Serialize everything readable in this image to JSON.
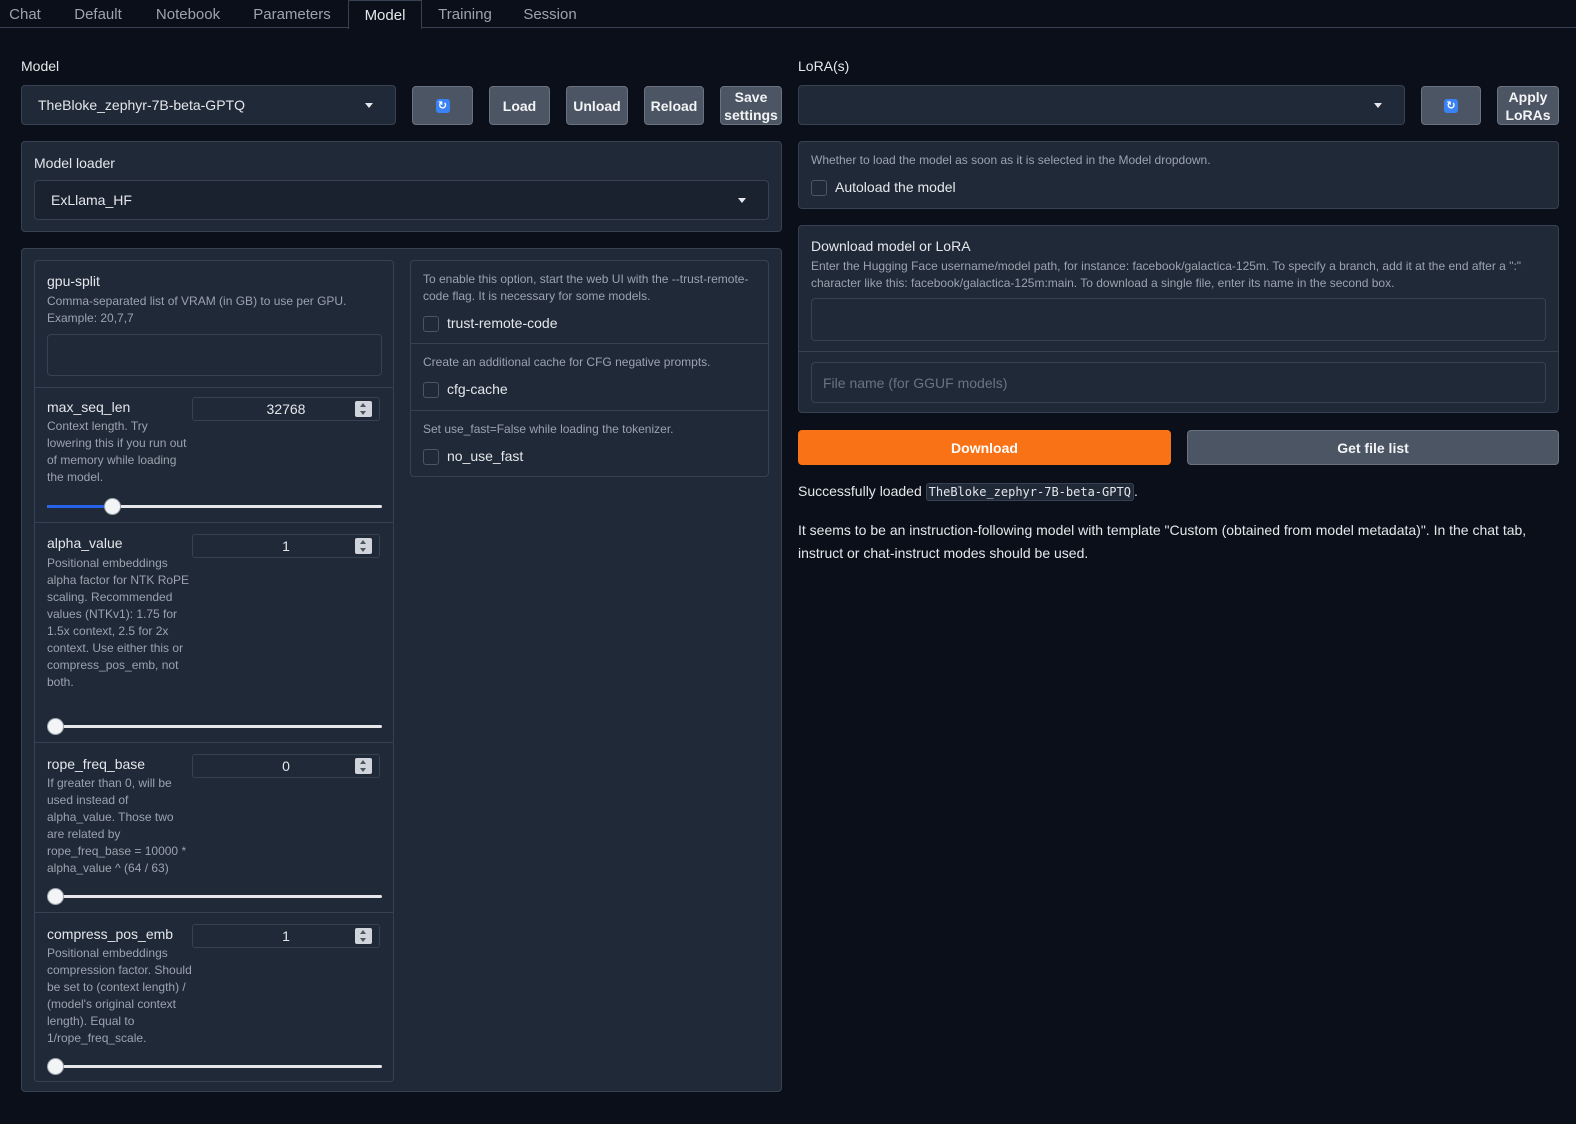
{
  "tabs": [
    "Chat",
    "Default",
    "Notebook",
    "Parameters",
    "Model",
    "Training",
    "Session"
  ],
  "active_tab": "Model",
  "model": {
    "label": "Model",
    "selected": "TheBloke_zephyr-7B-beta-GPTQ",
    "load": "Load",
    "unload": "Unload",
    "reload": "Reload",
    "save_settings": "Save settings"
  },
  "lora": {
    "label": "LoRA(s)",
    "selected": "",
    "apply": "Apply LoRAs"
  },
  "loader": {
    "label": "Model loader",
    "selected": "ExLlama_HF"
  },
  "gpu_split": {
    "label": "gpu-split",
    "info": "Comma-separated list of VRAM (in GB) to use per GPU. Example: 20,7,7",
    "value": ""
  },
  "sliders": {
    "max_seq_len": {
      "label": "max_seq_len",
      "value": "32768",
      "info": "Context length. Try lowering this if you run out of memory while loading the model.",
      "fraction": 0.18
    },
    "alpha_value": {
      "label": "alpha_value",
      "value": "1",
      "info": "Positional embeddings alpha factor for NTK RoPE scaling. Recommended values (NTKv1): 1.75 for 1.5x context, 2.5 for 2x context. Use either this or compress_pos_emb, not both.",
      "fraction": 0
    },
    "rope_freq_base": {
      "label": "rope_freq_base",
      "value": "0",
      "info": "If greater than 0, will be used instead of alpha_value. Those two are related by rope_freq_base = 10000 * alpha_value ^ (64 / 63)",
      "fraction": 0
    },
    "compress_pos_emb": {
      "label": "compress_pos_emb",
      "value": "1",
      "info": "Positional embeddings compression factor. Should be set to (context length) / (model's original context length). Equal to 1/rope_freq_scale.",
      "fraction": 0
    }
  },
  "checkboxes": {
    "trust_remote_code": {
      "info": "To enable this option, start the web UI with the --trust-remote-code flag. It is necessary for some models.",
      "label": "trust-remote-code",
      "checked": false
    },
    "cfg_cache": {
      "info": "Create an additional cache for CFG negative prompts.",
      "label": "cfg-cache",
      "checked": false
    },
    "no_use_fast": {
      "info": "Set use_fast=False while loading the tokenizer.",
      "label": "no_use_fast",
      "checked": false
    },
    "autoload": {
      "info": "Whether to load the model as soon as it is selected in the Model dropdown.",
      "label": "Autoload the model",
      "checked": false
    }
  },
  "download": {
    "title": "Download model or LoRA",
    "info": "Enter the Hugging Face username/model path, for instance: facebook/galactica-125m. To specify a branch, add it at the end after a \":\" character like this: facebook/galactica-125m:main. To download a single file, enter its name in the second box.",
    "value": "",
    "filename_placeholder": "File name (for GGUF models)",
    "download_button": "Download",
    "file_list_button": "Get file list"
  },
  "status": {
    "loaded_prefix": "Successfully loaded",
    "loaded_model": "TheBloke_zephyr-7B-beta-GPTQ",
    "loaded_suffix": ".",
    "message": "It seems to be an instruction-following model with template \"Custom (obtained from model metadata)\". In the chat tab, instruct or chat-instruct modes should be used."
  },
  "colors": {
    "accent": "#f97316",
    "background": "#0b0f19",
    "panel": "#1f2937",
    "slider_fill": "#2563eb"
  }
}
